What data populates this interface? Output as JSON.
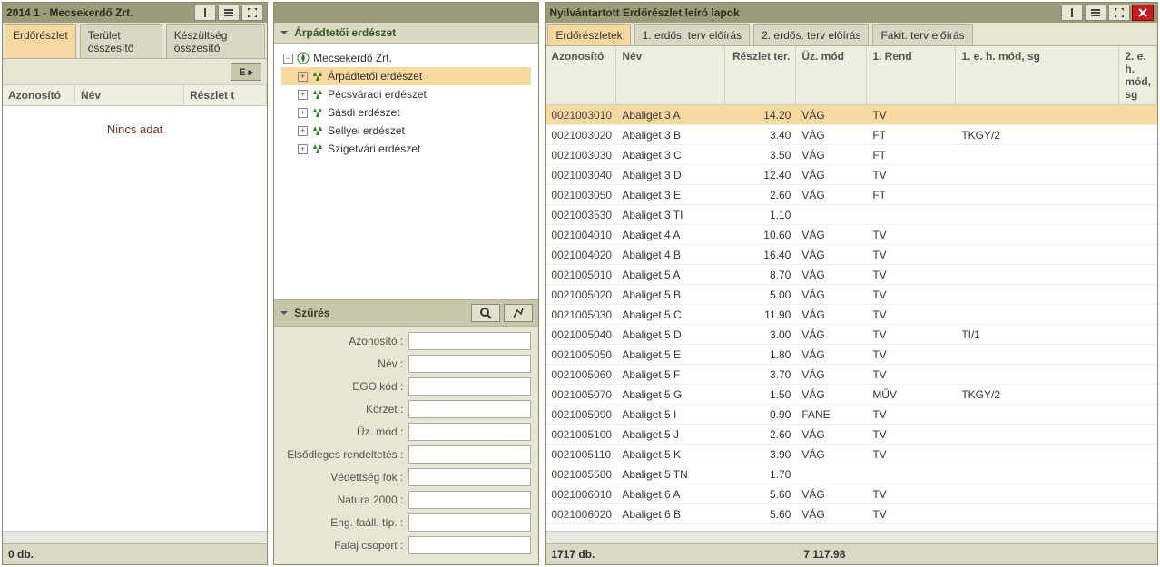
{
  "left": {
    "title": "2014 1 - Mecsekerdő Zrt.",
    "tabs": [
      "Erdőrészlet",
      "Terület összesítő",
      "Készültség összesítő"
    ],
    "ebtn": "E ▸",
    "columns": [
      "Azonosító",
      "Név",
      "Részlet t"
    ],
    "nodata": "Nincs adat",
    "status": "0 db."
  },
  "mid": {
    "tree_title": "Árpádtetői erdészet",
    "root": "Mecsekerdő Zrt.",
    "nodes": [
      "Árpádtetői erdészet",
      "Pécsváradi erdészet",
      "Sásdi erdészet",
      "Sellyei erdészet",
      "Szigetvári erdészet"
    ],
    "selected_node": 0,
    "filter_title": "Szűrés",
    "filter_labels": [
      "Azonosító :",
      "Név :",
      "EGO kód :",
      "Körzet :",
      "Üz. mód :",
      "Elsődleges rendeltetés :",
      "Védettség fok :",
      "Natura 2000 :",
      "Eng. faáll. típ. :",
      "Fafaj csoport :"
    ]
  },
  "right": {
    "title": "Nyilvántartott Erdőrészlet leíró lapok",
    "tabs": [
      "Erdőrészletek",
      "1. erdős. terv előírás",
      "2. erdős. terv előírás",
      "Fakit. terv előírás"
    ],
    "columns": [
      "Azonosító",
      "Név",
      "Részlet ter.",
      "Üz. mód",
      "1. Rend",
      "1. e. h. mód, sg",
      "2. e. h. mód, sg"
    ],
    "status_count": "1717 db.",
    "status_sum": "7 117.98",
    "rows": [
      {
        "id": "0021003010",
        "nev": "Abaliget 3 A",
        "ter": "14.20",
        "uz": "VÁG",
        "rend": "TV",
        "eh1": ""
      },
      {
        "id": "0021003020",
        "nev": "Abaliget 3 B",
        "ter": "3.40",
        "uz": "VÁG",
        "rend": "FT",
        "eh1": "TKGY/2"
      },
      {
        "id": "0021003030",
        "nev": "Abaliget 3 C",
        "ter": "3.50",
        "uz": "VÁG",
        "rend": "FT",
        "eh1": ""
      },
      {
        "id": "0021003040",
        "nev": "Abaliget 3 D",
        "ter": "12.40",
        "uz": "VÁG",
        "rend": "TV",
        "eh1": ""
      },
      {
        "id": "0021003050",
        "nev": "Abaliget 3 E",
        "ter": "2.60",
        "uz": "VÁG",
        "rend": "FT",
        "eh1": ""
      },
      {
        "id": "0021003530",
        "nev": "Abaliget 3 TI",
        "ter": "1.10",
        "uz": "",
        "rend": "",
        "eh1": ""
      },
      {
        "id": "0021004010",
        "nev": "Abaliget 4 A",
        "ter": "10.60",
        "uz": "VÁG",
        "rend": "TV",
        "eh1": ""
      },
      {
        "id": "0021004020",
        "nev": "Abaliget 4 B",
        "ter": "16.40",
        "uz": "VÁG",
        "rend": "TV",
        "eh1": ""
      },
      {
        "id": "0021005010",
        "nev": "Abaliget 5 A",
        "ter": "8.70",
        "uz": "VÁG",
        "rend": "TV",
        "eh1": ""
      },
      {
        "id": "0021005020",
        "nev": "Abaliget 5 B",
        "ter": "5.00",
        "uz": "VÁG",
        "rend": "TV",
        "eh1": ""
      },
      {
        "id": "0021005030",
        "nev": "Abaliget 5 C",
        "ter": "11.90",
        "uz": "VÁG",
        "rend": "TV",
        "eh1": ""
      },
      {
        "id": "0021005040",
        "nev": "Abaliget 5 D",
        "ter": "3.00",
        "uz": "VÁG",
        "rend": "TV",
        "eh1": "TI/1"
      },
      {
        "id": "0021005050",
        "nev": "Abaliget 5 E",
        "ter": "1.80",
        "uz": "VÁG",
        "rend": "TV",
        "eh1": ""
      },
      {
        "id": "0021005060",
        "nev": "Abaliget 5 F",
        "ter": "3.70",
        "uz": "VÁG",
        "rend": "TV",
        "eh1": ""
      },
      {
        "id": "0021005070",
        "nev": "Abaliget 5 G",
        "ter": "1.50",
        "uz": "VÁG",
        "rend": "MŰV",
        "eh1": "TKGY/2"
      },
      {
        "id": "0021005090",
        "nev": "Abaliget 5 I",
        "ter": "0.90",
        "uz": "FANE",
        "rend": "TV",
        "eh1": ""
      },
      {
        "id": "0021005100",
        "nev": "Abaliget 5 J",
        "ter": "2.60",
        "uz": "VÁG",
        "rend": "TV",
        "eh1": ""
      },
      {
        "id": "0021005110",
        "nev": "Abaliget 5 K",
        "ter": "3.90",
        "uz": "VÁG",
        "rend": "TV",
        "eh1": ""
      },
      {
        "id": "0021005580",
        "nev": "Abaliget 5 TN",
        "ter": "1.70",
        "uz": "",
        "rend": "",
        "eh1": ""
      },
      {
        "id": "0021006010",
        "nev": "Abaliget 6 A",
        "ter": "5.60",
        "uz": "VÁG",
        "rend": "TV",
        "eh1": ""
      },
      {
        "id": "0021006020",
        "nev": "Abaliget 6 B",
        "ter": "5.60",
        "uz": "VÁG",
        "rend": "TV",
        "eh1": ""
      }
    ]
  }
}
